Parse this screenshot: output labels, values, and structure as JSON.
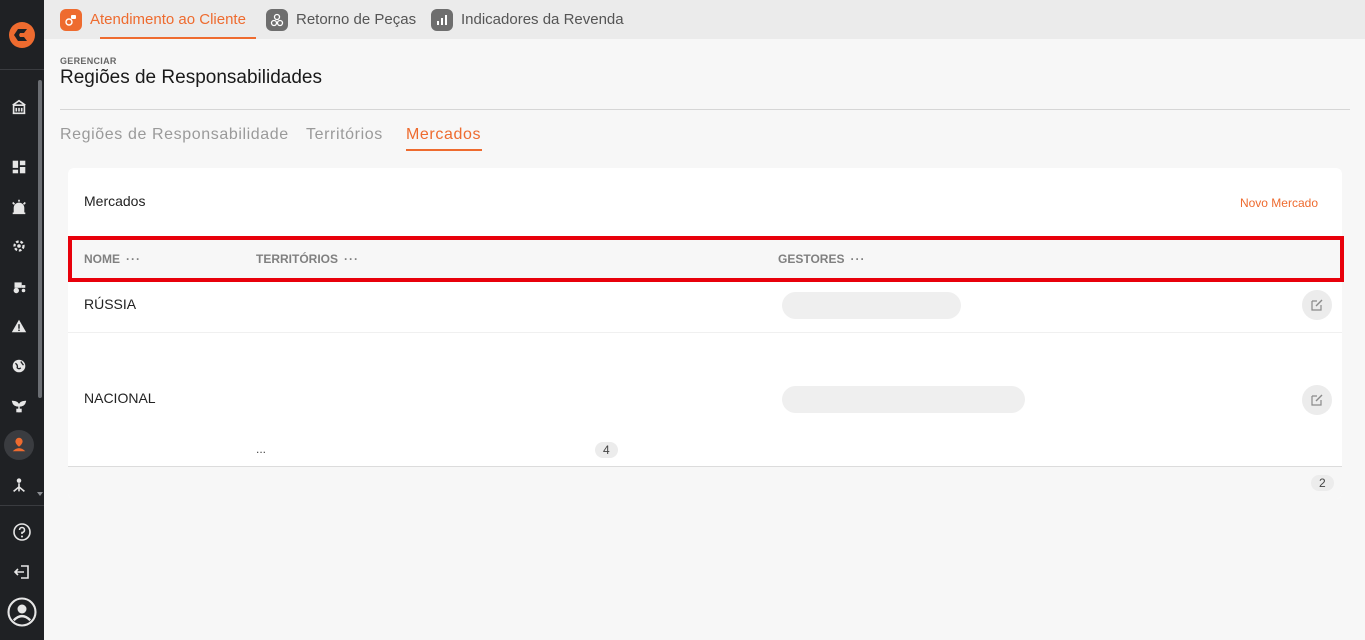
{
  "colors": {
    "accent": "#ee6b2f",
    "sidebar": "#1f2124",
    "highlight": "#e8000b"
  },
  "sidebar": {
    "icons": [
      "logo-icon",
      "dealer-building-icon",
      "dashboard-icon",
      "alarm-icon",
      "gear-settings-icon",
      "tractor-icon",
      "warning-icon",
      "globe-icon",
      "seedling-icon",
      "location-user-icon",
      "hierarchy-icon"
    ],
    "bottom": [
      "help-icon",
      "logout-icon",
      "user-avatar-icon"
    ]
  },
  "topbar": {
    "tabs": [
      {
        "label": "Atendimento ao Cliente",
        "icon": "customer-service-icon",
        "active": true
      },
      {
        "label": "Retorno de Peças",
        "icon": "parts-return-icon",
        "active": false
      },
      {
        "label": "Indicadores da Revenda",
        "icon": "bar-chart-icon",
        "active": false
      }
    ]
  },
  "header": {
    "eyebrow": "GERENCIAR",
    "title": "Regiões de Responsabilidades"
  },
  "subtabs": [
    {
      "label": "Regiões de Responsabilidade",
      "active": false
    },
    {
      "label": "Territórios",
      "active": false
    },
    {
      "label": "Mercados",
      "active": true
    }
  ],
  "card": {
    "title": "Mercados",
    "action": "Novo Mercado",
    "columns": [
      {
        "label": "NOME",
        "menu": "···"
      },
      {
        "label": "TERRITÓRIOS",
        "menu": "···"
      },
      {
        "label": "GESTORES",
        "menu": "···"
      }
    ],
    "rows": [
      {
        "name": "RÚSSIA"
      },
      {
        "name": "NACIONAL",
        "territories_more": "...",
        "territories_count": "4"
      }
    ],
    "footer_count": "2"
  }
}
